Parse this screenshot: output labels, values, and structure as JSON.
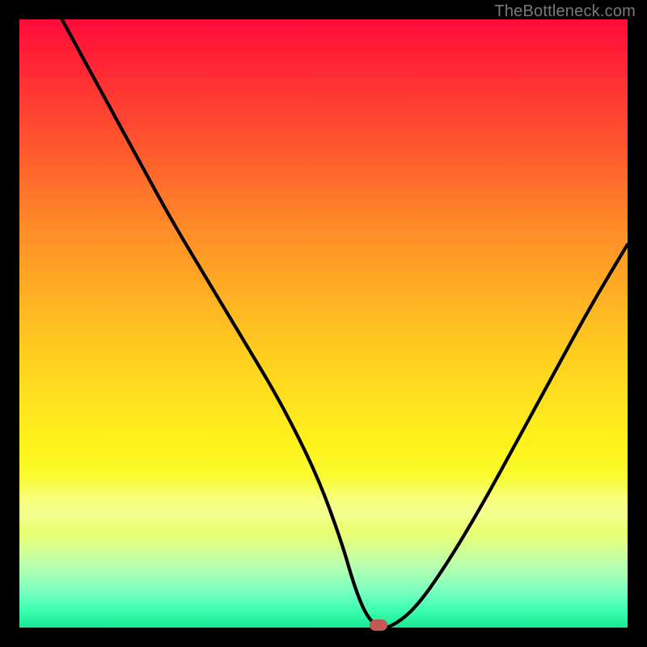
{
  "watermark": "TheBottleneck.com",
  "colors": {
    "frame": "#000000",
    "curve": "#000000",
    "marker": "#c15a54",
    "gradient_top": "#ff0a3a",
    "gradient_bottom": "#18e895"
  },
  "chart_data": {
    "type": "line",
    "title": "",
    "xlabel": "",
    "ylabel": "",
    "xlim": [
      0,
      100
    ],
    "ylim": [
      0,
      100
    ],
    "grid": false,
    "legend": false,
    "x": [
      7,
      13,
      19,
      25,
      31,
      37,
      43,
      49,
      53,
      55,
      57,
      59,
      61,
      65,
      70,
      76,
      82,
      88,
      94,
      100
    ],
    "values": [
      100,
      89,
      78,
      67,
      57,
      47,
      37,
      25,
      14,
      7,
      2,
      0,
      0,
      3,
      10,
      20,
      31,
      42,
      53,
      63
    ],
    "marker": {
      "x": 59,
      "y": 0
    },
    "pale_band": {
      "y0": 16,
      "y1": 25
    },
    "notes": "Bottleneck-style V curve over a red-to-green vertical gradient. y=0 at bottom (green), y=100 at top (red). Values approximate from gradient position."
  }
}
